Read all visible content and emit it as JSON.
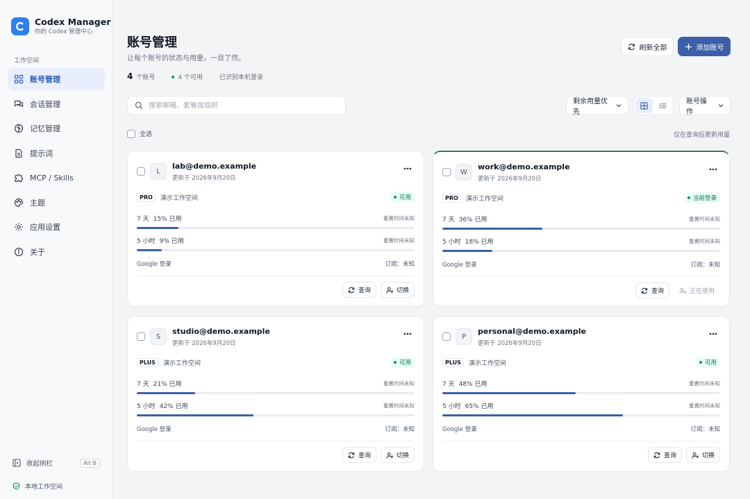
{
  "sidebar": {
    "app_name": "Codex Manager",
    "app_subtitle": "你的 Codex 管理中心",
    "section_label": "工作空间",
    "items": [
      {
        "label": "账号管理",
        "icon": "grid-icon",
        "active": true
      },
      {
        "label": "会话管理",
        "icon": "chat-icon"
      },
      {
        "label": "记忆管理",
        "icon": "brain-icon"
      },
      {
        "label": "提示词",
        "icon": "document-icon"
      },
      {
        "label": "MCP / Skills",
        "icon": "puzzle-icon"
      },
      {
        "label": "主题",
        "icon": "palette-icon"
      },
      {
        "label": "应用设置",
        "icon": "gear-icon"
      },
      {
        "label": "关于",
        "icon": "info-icon"
      }
    ],
    "collapse_label": "收起侧栏",
    "collapse_shortcut": "Alt B",
    "workspace_label": "本地工作空间"
  },
  "header": {
    "title": "账号管理",
    "subtitle": "让每个账号的状态与用量，一目了然。",
    "stats": {
      "count": "4",
      "count_label": "个账号",
      "available": "4 个可用",
      "local_login": "已识别本机登录"
    },
    "refresh_label": "刷新全部",
    "add_label": "添加账号"
  },
  "toolbar": {
    "search_placeholder": "搜索邮箱、套餐或组织",
    "sort_label": "剩余用量优先",
    "actions_label": "账号操作",
    "select_all_label": "全选",
    "note": "仅在查询后更新用量"
  },
  "colors": {
    "accent": "#3b5fa9",
    "brand": "#2f7ff0",
    "available_green": "#047857",
    "current_border": "#2f7a5c"
  },
  "accounts": [
    {
      "initial": "L",
      "email": "lab@demo.example",
      "updated": "更新于 2026年9月20日",
      "plan": "PRO",
      "workspace": "演示工作空间",
      "status": "可用",
      "usage_7d_label": "7 天",
      "usage_7d_text": "15% 已用",
      "usage_7d_pct": 15,
      "usage_7d_reset": "重置时间未知",
      "usage_5h_label": "5 小时",
      "usage_5h_text": "9% 已用",
      "usage_5h_pct": 9,
      "usage_5h_reset": "重置时间未知",
      "login": "Google 登录",
      "subscription": "订阅：未知",
      "query_label": "查询",
      "switch_label": "切换",
      "in_use": false
    },
    {
      "initial": "W",
      "email": "work@demo.example",
      "updated": "更新于 2026年9月20日",
      "plan": "PRO",
      "workspace": "演示工作空间",
      "status": "当前登录",
      "usage_7d_label": "7 天",
      "usage_7d_text": "36% 已用",
      "usage_7d_pct": 36,
      "usage_7d_reset": "重置时间未知",
      "usage_5h_label": "5 小时",
      "usage_5h_text": "18% 已用",
      "usage_5h_pct": 18,
      "usage_5h_reset": "重置时间未知",
      "login": "Google 登录",
      "subscription": "订阅：未知",
      "query_label": "查询",
      "switch_label": "正在使用",
      "in_use": true
    },
    {
      "initial": "S",
      "email": "studio@demo.example",
      "updated": "更新于 2026年9月20日",
      "plan": "PLUS",
      "workspace": "演示工作空间",
      "status": "可用",
      "usage_7d_label": "7 天",
      "usage_7d_text": "21% 已用",
      "usage_7d_pct": 21,
      "usage_7d_reset": "重置时间未知",
      "usage_5h_label": "5 小时",
      "usage_5h_text": "42% 已用",
      "usage_5h_pct": 42,
      "usage_5h_reset": "重置时间未知",
      "login": "Google 登录",
      "subscription": "订阅：未知",
      "query_label": "查询",
      "switch_label": "切换",
      "in_use": false
    },
    {
      "initial": "P",
      "email": "personal@demo.example",
      "updated": "更新于 2026年9月20日",
      "plan": "PLUS",
      "workspace": "演示工作空间",
      "status": "可用",
      "usage_7d_label": "7 天",
      "usage_7d_text": "48% 已用",
      "usage_7d_pct": 48,
      "usage_7d_reset": "重置时间未知",
      "usage_5h_label": "5 小时",
      "usage_5h_text": "65% 已用",
      "usage_5h_pct": 65,
      "usage_5h_reset": "重置时间未知",
      "login": "Google 登录",
      "subscription": "订阅：未知",
      "query_label": "查询",
      "switch_label": "切换",
      "in_use": false
    }
  ]
}
